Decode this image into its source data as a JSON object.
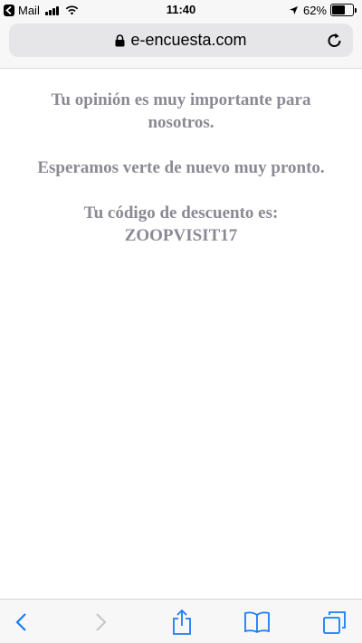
{
  "status_bar": {
    "back_app": "Mail",
    "time": "11:40",
    "battery_text": "62%",
    "battery_level": 0.62
  },
  "address_bar": {
    "url": "e-encuesta.com"
  },
  "content": {
    "line1": "Tu opinión es muy importante para nosotros.",
    "line2": "Esperamos verte de nuevo muy pronto.",
    "line3a": "Tu código de descuento es:",
    "code": "ZOOPVISIT17"
  },
  "colors": {
    "text": "#8a8a94",
    "accent": "#1a7cf5",
    "disabled": "#c7c7cc"
  }
}
